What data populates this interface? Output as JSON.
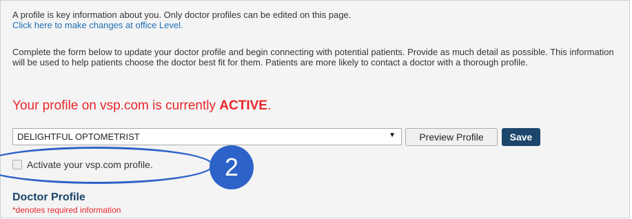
{
  "intro": {
    "text": "A profile is key information about you. Only doctor profiles can be edited on this page.",
    "link": "Click here to make changes at office Level."
  },
  "description": "Complete the form below to update your doctor profile and begin connecting with potential patients. Provide as much detail as possible. This information will be used to help patients choose the doctor best fit for them. Patients are more likely to contact a doctor with a thorough profile.",
  "status": {
    "prefix": "Your profile on vsp.com is currently ",
    "state": "ACTIVE",
    "suffix": "."
  },
  "form": {
    "doctor_select_value": "DELIGHTFUL OPTOMETRIST",
    "preview_label": "Preview Profile",
    "save_label": "Save",
    "activate_label": "Activate your vsp.com profile.",
    "activate_checked": false
  },
  "annotation": {
    "step_number": "2"
  },
  "doctor_profile": {
    "title": "Doctor Profile",
    "required_note": "*denotes required information"
  },
  "colors": {
    "status_red": "#e8262b",
    "save_button": "#1c466b",
    "annotation_blue": "#2d62c8",
    "link_blue": "#1f6fb5"
  }
}
